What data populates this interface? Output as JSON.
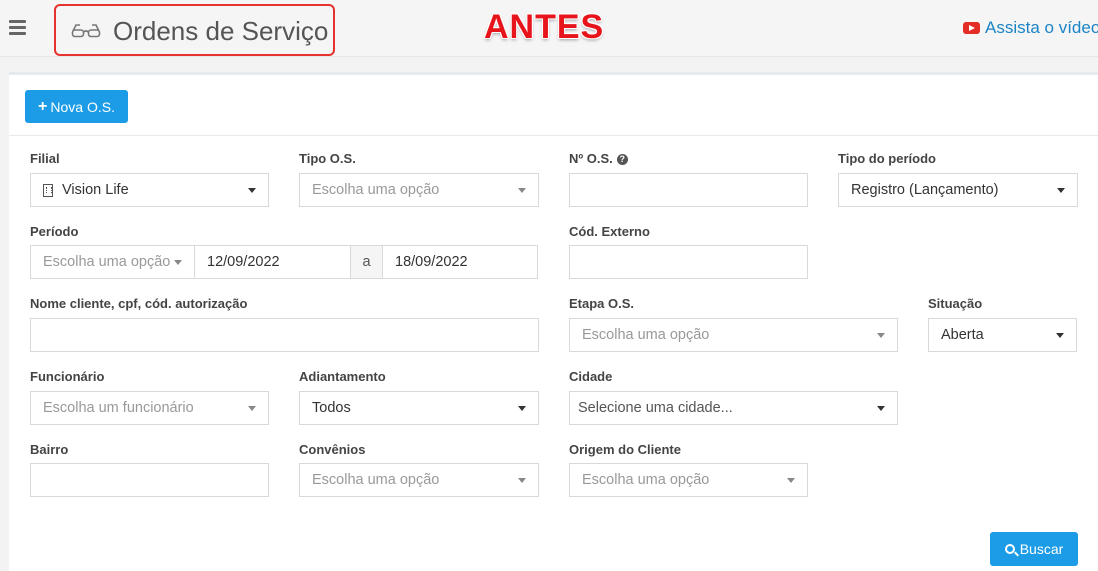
{
  "header": {
    "page_title": "Ordens de Serviço",
    "title_icon": "glasses-icon",
    "annotation": "ANTES",
    "video_link": "Assista o vídeo",
    "video_icon": "youtube-icon"
  },
  "toolbar": {
    "new_button": "Nova O.S."
  },
  "filters": {
    "filial": {
      "label": "Filial",
      "value": "Vision Life"
    },
    "tipo_os": {
      "label": "Tipo O.S.",
      "placeholder": "Escolha uma opção"
    },
    "numero_os": {
      "label": "Nº O.S.",
      "value": ""
    },
    "tipo_periodo": {
      "label": "Tipo do período",
      "value": "Registro (Lançamento)"
    },
    "periodo": {
      "label": "Período",
      "placeholder": "Escolha uma opção",
      "start": "12/09/2022",
      "separator": "a",
      "end": "18/09/2022"
    },
    "cod_externo": {
      "label": "Cód. Externo",
      "value": ""
    },
    "nome_cliente": {
      "label": "Nome cliente, cpf, cód. autorização",
      "value": ""
    },
    "etapa_os": {
      "label": "Etapa O.S.",
      "placeholder": "Escolha uma opção"
    },
    "situacao": {
      "label": "Situação",
      "value": "Aberta"
    },
    "funcionario": {
      "label": "Funcionário",
      "placeholder": "Escolha um funcionário"
    },
    "adiantamento": {
      "label": "Adiantamento",
      "value": "Todos"
    },
    "cidade": {
      "label": "Cidade",
      "placeholder": "Selecione uma cidade..."
    },
    "bairro": {
      "label": "Bairro",
      "value": ""
    },
    "convenios": {
      "label": "Convênios",
      "placeholder": "Escolha uma opção"
    },
    "origem_cliente": {
      "label": "Origem do Cliente",
      "placeholder": "Escolha uma opção"
    }
  },
  "actions": {
    "search_button": "Buscar"
  },
  "colors": {
    "primary": "#1c9ce6",
    "annotation_red": "#e8141b",
    "highlight_border": "#e5322d",
    "link": "#1c84c6"
  }
}
